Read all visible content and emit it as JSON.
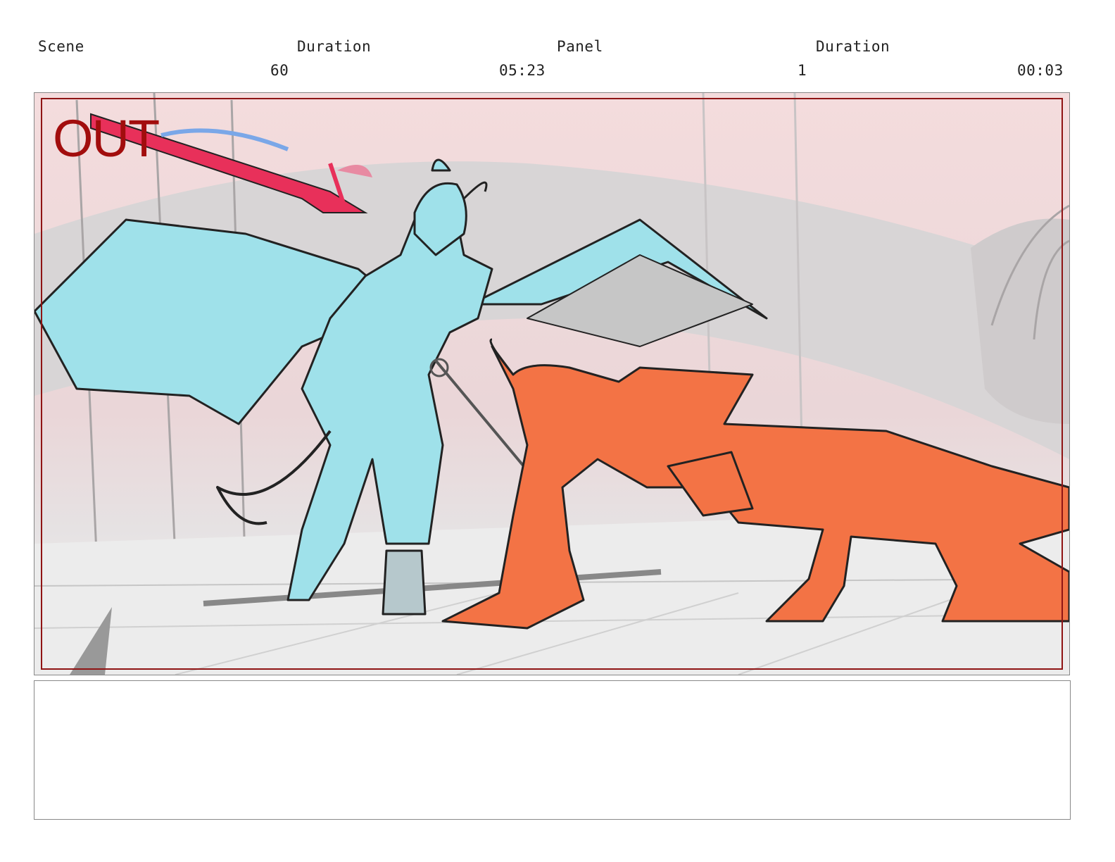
{
  "header": {
    "scene_label": "Scene",
    "scene_duration_label": "Duration",
    "panel_label": "Panel",
    "panel_duration_label": "Duration",
    "scene_value": "60",
    "scene_duration_value": "05:23",
    "panel_value": "1",
    "panel_duration_value": "00:03"
  },
  "panel": {
    "overlay_text": "OUT",
    "overlay_color": "#a20d0d",
    "character_left_color": "#9fe1ea",
    "character_right_color": "#f37345",
    "weapon_color": "#e8305a"
  },
  "notes": {
    "text": ""
  }
}
